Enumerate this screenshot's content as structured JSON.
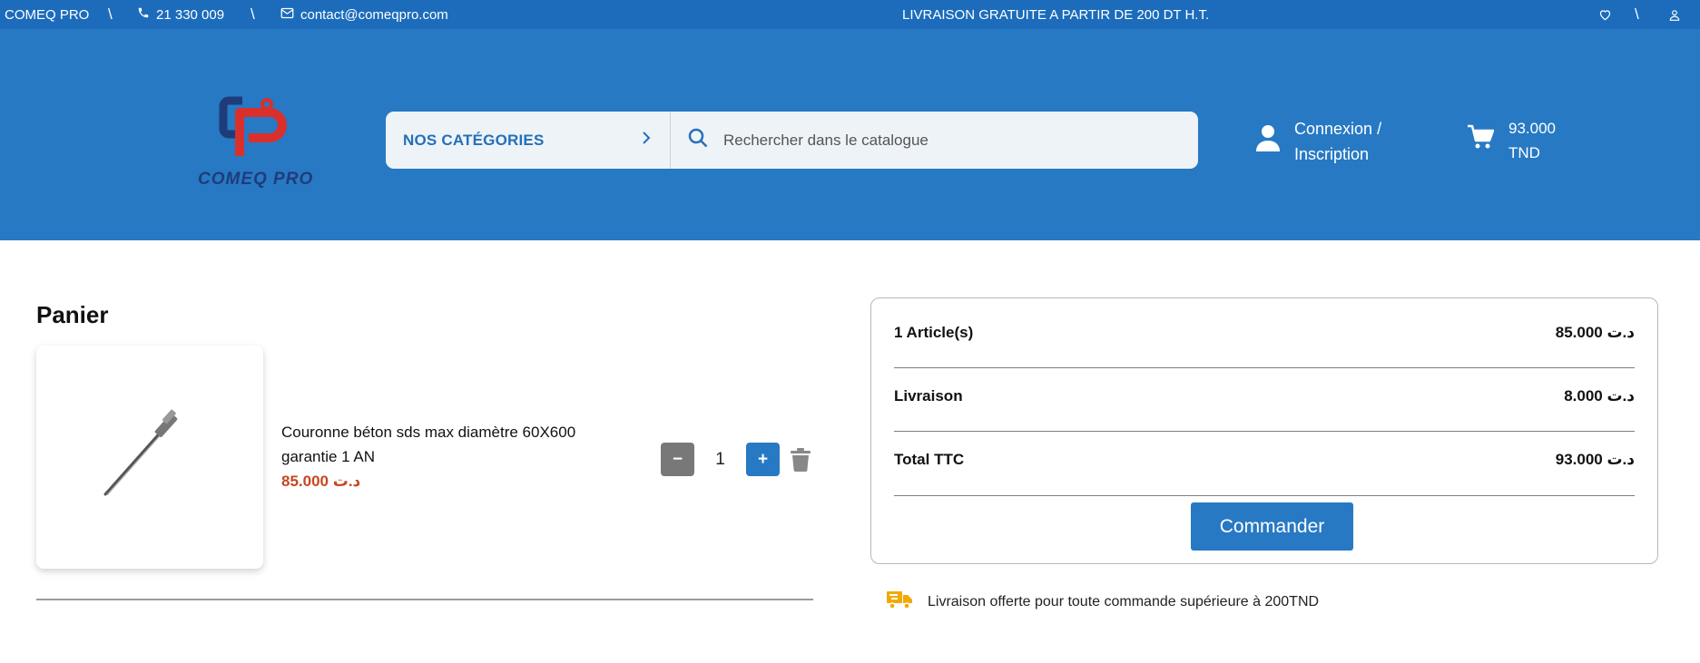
{
  "topbar": {
    "brand": "COMEQ PRO",
    "phone": "21 330 009",
    "email": "contact@comeqpro.com",
    "separator": "\\",
    "promo": "LIVRAISON GRATUITE A PARTIR DE 200 DT H.T."
  },
  "header": {
    "logo_text": "COMEQ PRO",
    "categories_label": "NOS CATÉGORIES",
    "search_placeholder": "Rechercher dans le catalogue",
    "account_line1": "Connexion /",
    "account_line2": "Inscription",
    "cart_amount": "93.000",
    "cart_currency": "TND"
  },
  "cart": {
    "title": "Panier",
    "items": [
      {
        "name": "Couronne béton sds max diamètre 60X600 garantie 1 AN",
        "price": "85.000 د.ت",
        "quantity": "1",
        "minus_label": "−",
        "plus_label": "+"
      }
    ]
  },
  "summary": {
    "articles_label": "1 Article(s)",
    "articles_value": "85.000 د.ت",
    "delivery_label": "Livraison",
    "delivery_value": "8.000 د.ت",
    "total_label": "Total TTC",
    "total_value": "93.000 د.ت",
    "checkout_label": "Commander"
  },
  "delivery_note": "Livraison offerte pour toute commande supérieure à 200TND",
  "colors": {
    "topbar": "#1c6cbb",
    "header": "#2779c4",
    "price": "#c6471e",
    "truck": "#f2a900",
    "logo_red": "#d9302c",
    "logo_navy": "#1f3c7a"
  }
}
